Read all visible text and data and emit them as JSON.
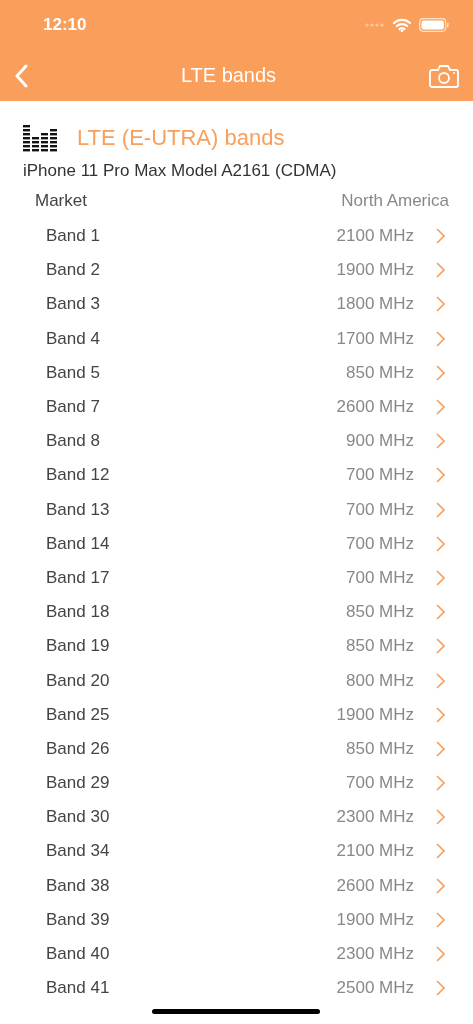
{
  "status_bar": {
    "time": "12:10"
  },
  "nav": {
    "title": "LTE bands"
  },
  "header": {
    "title": "LTE (E-UTRA) bands",
    "subtitle": "iPhone 11 Pro Max Model A2161 (CDMA)"
  },
  "market": {
    "label": "Market",
    "value": "North America"
  },
  "bands": [
    {
      "name": "Band 1",
      "frequency": "2100 MHz"
    },
    {
      "name": "Band 2",
      "frequency": "1900 MHz"
    },
    {
      "name": "Band 3",
      "frequency": "1800 MHz"
    },
    {
      "name": "Band 4",
      "frequency": "1700 MHz"
    },
    {
      "name": "Band 5",
      "frequency": "850 MHz"
    },
    {
      "name": "Band 7",
      "frequency": "2600 MHz"
    },
    {
      "name": "Band 8",
      "frequency": "900 MHz"
    },
    {
      "name": "Band 12",
      "frequency": "700 MHz"
    },
    {
      "name": "Band 13",
      "frequency": "700 MHz"
    },
    {
      "name": "Band 14",
      "frequency": "700 MHz"
    },
    {
      "name": "Band 17",
      "frequency": "700 MHz"
    },
    {
      "name": "Band 18",
      "frequency": "850 MHz"
    },
    {
      "name": "Band 19",
      "frequency": "850 MHz"
    },
    {
      "name": "Band 20",
      "frequency": "800 MHz"
    },
    {
      "name": "Band 25",
      "frequency": "1900 MHz"
    },
    {
      "name": "Band 26",
      "frequency": "850 MHz"
    },
    {
      "name": "Band 29",
      "frequency": "700 MHz"
    },
    {
      "name": "Band 30",
      "frequency": "2300 MHz"
    },
    {
      "name": "Band 34",
      "frequency": "2100 MHz"
    },
    {
      "name": "Band 38",
      "frequency": "2600 MHz"
    },
    {
      "name": "Band 39",
      "frequency": "1900 MHz"
    },
    {
      "name": "Band 40",
      "frequency": "2300 MHz"
    },
    {
      "name": "Band 41",
      "frequency": "2500 MHz"
    }
  ]
}
